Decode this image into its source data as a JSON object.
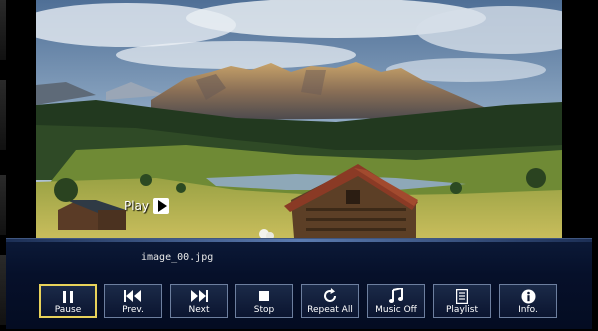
{
  "player": {
    "filename": "image_00.jpg",
    "state_label": "Play"
  },
  "controls": [
    {
      "label": "Pause",
      "icon": "pause-icon"
    },
    {
      "label": "Prev.",
      "icon": "previous-icon"
    },
    {
      "label": "Next",
      "icon": "next-icon"
    },
    {
      "label": "Stop",
      "icon": "stop-icon"
    },
    {
      "label": "Repeat All",
      "icon": "repeat-icon"
    },
    {
      "label": "Music Off",
      "icon": "music-note-icon"
    },
    {
      "label": "Playlist",
      "icon": "playlist-icon"
    },
    {
      "label": "Info.",
      "icon": "info-icon"
    }
  ],
  "colors": {
    "bar_background": "#06102a",
    "button_border": "#6d7f9f",
    "selected_border": "#e8d25a"
  }
}
